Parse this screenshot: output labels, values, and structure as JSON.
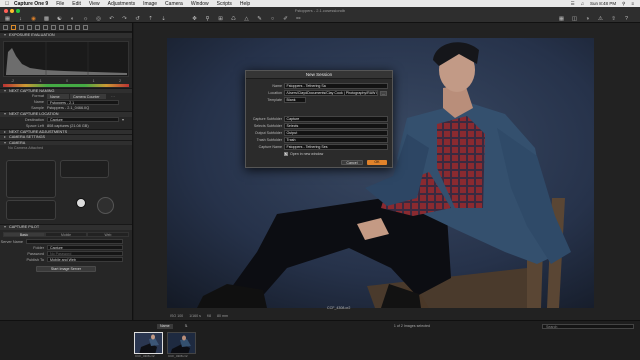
{
  "menubar": {
    "app": "Capture One 9",
    "items": [
      "File",
      "Edit",
      "View",
      "Adjustments",
      "Image",
      "Camera",
      "Window",
      "Scripts",
      "Help"
    ],
    "clock": "Sun 8:48 PM"
  },
  "window": {
    "title": "Fstoppers - 2.1.cosessiondb"
  },
  "left": {
    "sections": {
      "exposure_eval": "EXPOSURE EVALUATION",
      "capture_naming": "NEXT CAPTURE NAMING",
      "capture_location": "NEXT CAPTURE LOCATION",
      "capture_adjustments": "NEXT CAPTURE ADJUSTMENTS",
      "camera_settings": "CAMERA SETTINGS",
      "camera": "CAMERA",
      "capture_pilot": "CAPTURE PILOT"
    },
    "exposure_scale": [
      "-2",
      "-1",
      "0",
      "1",
      "2"
    ],
    "naming": {
      "format_label": "Format",
      "format_values": [
        "Name",
        "Camera Counter"
      ],
      "name_label": "Name",
      "name_value": "Fstoppers - 2.1",
      "sample_label": "Sample",
      "sample_value": "Fstoppers - 2.1_0466.IIQ"
    },
    "location": {
      "dest_label": "Destination",
      "dest_value": "Capture",
      "space_label": "Space Left",
      "space_value": "808 captures (21.08 GB)"
    },
    "no_camera": "No Camera Attached",
    "pilot": {
      "tabs": [
        "Basic",
        "Mobile",
        "Web"
      ],
      "server_label": "Server Name",
      "folder_label": "Folder",
      "folder_value": "Capture",
      "password_label": "Password",
      "password_placeholder": "No Password",
      "publish_label": "Publish To",
      "publish_value": "Mobile and Web",
      "start_button": "Start Image Server"
    }
  },
  "viewer": {
    "status": [
      "ISO 100",
      "1/160 s",
      "f/8",
      "80 mm"
    ],
    "filename": "CCF_4308.cr2"
  },
  "dialog": {
    "title": "New Session",
    "name_label": "Name",
    "name_value": "Fstoppers - Tethering Sa",
    "location_label": "Location",
    "location_value": "/Users/ClaydDocuments/Clay Cook | Photography/RAW Photo Back",
    "browse_label": "...",
    "template_label": "Template",
    "template_value": "Blank",
    "capture_label": "Capture Subfolder",
    "capture_value": "Capture",
    "selects_label": "Selects Subfolder",
    "selects_value": "Selects",
    "output_label": "Output Subfolder",
    "output_value": "Output",
    "trash_label": "Trash Subfolder",
    "trash_value": "Trash",
    "capname_label": "Capture Name",
    "capname_value": "Fstoppers - Tethering Ses",
    "open_label": "Open in new window",
    "cancel_label": "Cancel",
    "ok_label": "OK"
  },
  "filmstrip": {
    "sort_label": "Name",
    "count": "1 of 2 Images selected",
    "search_placeholder": "Search",
    "thumbs": [
      "CCF_4308.cr2",
      "CCF_4308.cr2"
    ]
  },
  "colors": {
    "accent": "#e0822a",
    "panel": "#262626",
    "backdrop": "#2a3446"
  }
}
